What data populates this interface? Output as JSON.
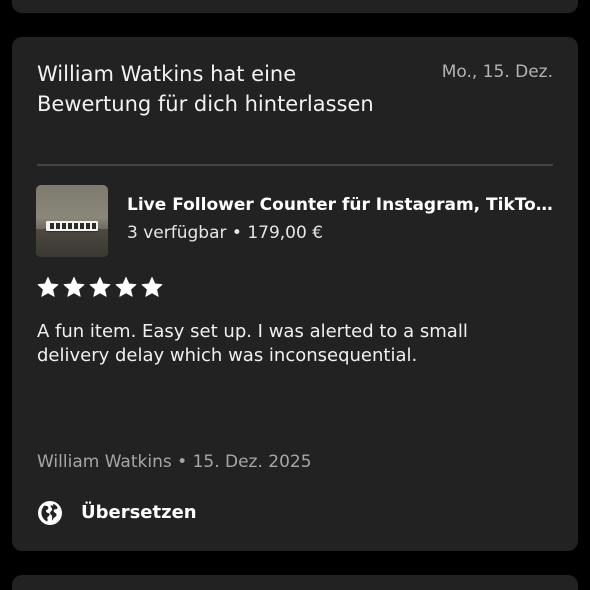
{
  "notification": {
    "title": "William Watkins hat eine Bewertung für dich hinterlassen",
    "date": "Mo., 15. Dez."
  },
  "product": {
    "title": "Live Follower Counter für Instagram, TikTo...",
    "stock": "3 verfügbar",
    "separator": " • ",
    "price": "179,00 €",
    "thumbnail_icon": "product-thumbnail-image"
  },
  "review": {
    "rating": 5,
    "rating_max": 5,
    "text": "A fun item. Easy set up. I was alerted to a small delivery delay which was inconsequential.",
    "author": "William Watkins",
    "separator": " • ",
    "date": "15. Dez. 2025"
  },
  "actions": {
    "translate_label": "Übersetzen",
    "translate_icon": "globe-icon"
  },
  "colors": {
    "background": "#000000",
    "card": "#222222",
    "divider": "#444444",
    "muted_text": "#a6a6a6",
    "star": "#ffffff"
  }
}
